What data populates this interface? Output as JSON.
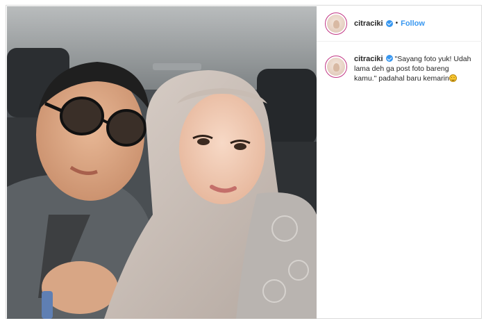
{
  "post": {
    "username": "citraciki",
    "follow_label": "Follow",
    "separator": "•",
    "caption": "\"Sayang foto yuk! Udah lama deh ga post foto bareng kamu.\" padahal baru kemarin",
    "caption_emoji": "smiling-face-emoji",
    "verified_icon": "verified-badge-icon",
    "photo": "car-selfie-photo"
  },
  "colors": {
    "follow": "#3897f0",
    "verified": "#3897f0",
    "avatar_ring": "#c13584",
    "border": "#dbdbdb"
  }
}
